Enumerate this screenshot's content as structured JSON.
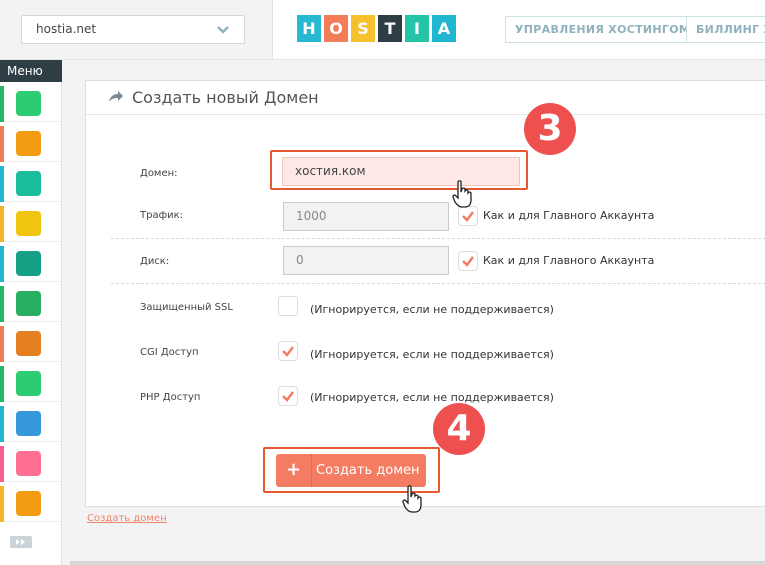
{
  "header": {
    "domain_selected": "hostia.net",
    "logo_letters": [
      "H",
      "O",
      "S",
      "T",
      "I",
      "A"
    ],
    "logo_colors": [
      "#27b8d2",
      "#f37d57",
      "#f6c12c",
      "#2f3d44",
      "#25c4a7",
      "#1fb6d0"
    ],
    "nav": [
      "УПРАВЛЕНИЯ ХОСТИНГОМ",
      "БИЛЛИНГ ХО"
    ]
  },
  "sidebar": {
    "title": "Меню",
    "items": [
      {
        "icon": "home-icon",
        "color": "#2ecc71",
        "stripe": "#25b765"
      },
      {
        "icon": "folder-icon",
        "color": "#f39c12",
        "stripe": "#f07f56"
      },
      {
        "icon": "globe-www-icon",
        "color": "#1abc9c",
        "stripe": "#22b8cf"
      },
      {
        "icon": "database-icon",
        "color": "#f1c40f",
        "stripe": "#f5b52a"
      },
      {
        "icon": "mail-icon",
        "color": "#16a085",
        "stripe": "#22b8cf"
      },
      {
        "icon": "ftp-icon",
        "color": "#27ae60",
        "stripe": "#25b765"
      },
      {
        "icon": "clock-icon",
        "color": "#e67e22",
        "stripe": "#f07f56"
      },
      {
        "icon": "cron-calendar-icon",
        "color": "#2ecc71",
        "stripe": "#25b765"
      },
      {
        "icon": "php-icon",
        "color": "#3498db",
        "stripe": "#22b8cf"
      },
      {
        "icon": "shield-icon",
        "color": "#ff6f91",
        "stripe": "#f5608e"
      },
      {
        "icon": "user-support-icon",
        "color": "#f39c12",
        "stripe": "#f5b52a"
      }
    ]
  },
  "panel": {
    "title": "Создать новый Домен",
    "domain_label": "Домен:",
    "domain_value": "хостия.ком",
    "traffic_label": "Трафик:",
    "traffic_value": "1000",
    "traffic_note": "Как и для Главного Аккаунта",
    "disk_label": "Диск:",
    "disk_value": "0",
    "disk_note": "Как и для Главного Аккаунта",
    "ssl_label": "Защищенный SSL",
    "ssl_note": "(Игнорируется, если не поддерживается)",
    "cgi_label": "CGI Доступ",
    "cgi_note": "(Игнорируется, если не поддерживается)",
    "php_label": "PHP Доступ",
    "php_note": "(Игнорируется, если не поддерживается)",
    "submit_label": "Создать домен",
    "footer_link": "Создать домен"
  },
  "annotations": {
    "step_a": "3",
    "step_b": "4",
    "color": "#ee4f4f"
  },
  "accent": "#f47c62"
}
